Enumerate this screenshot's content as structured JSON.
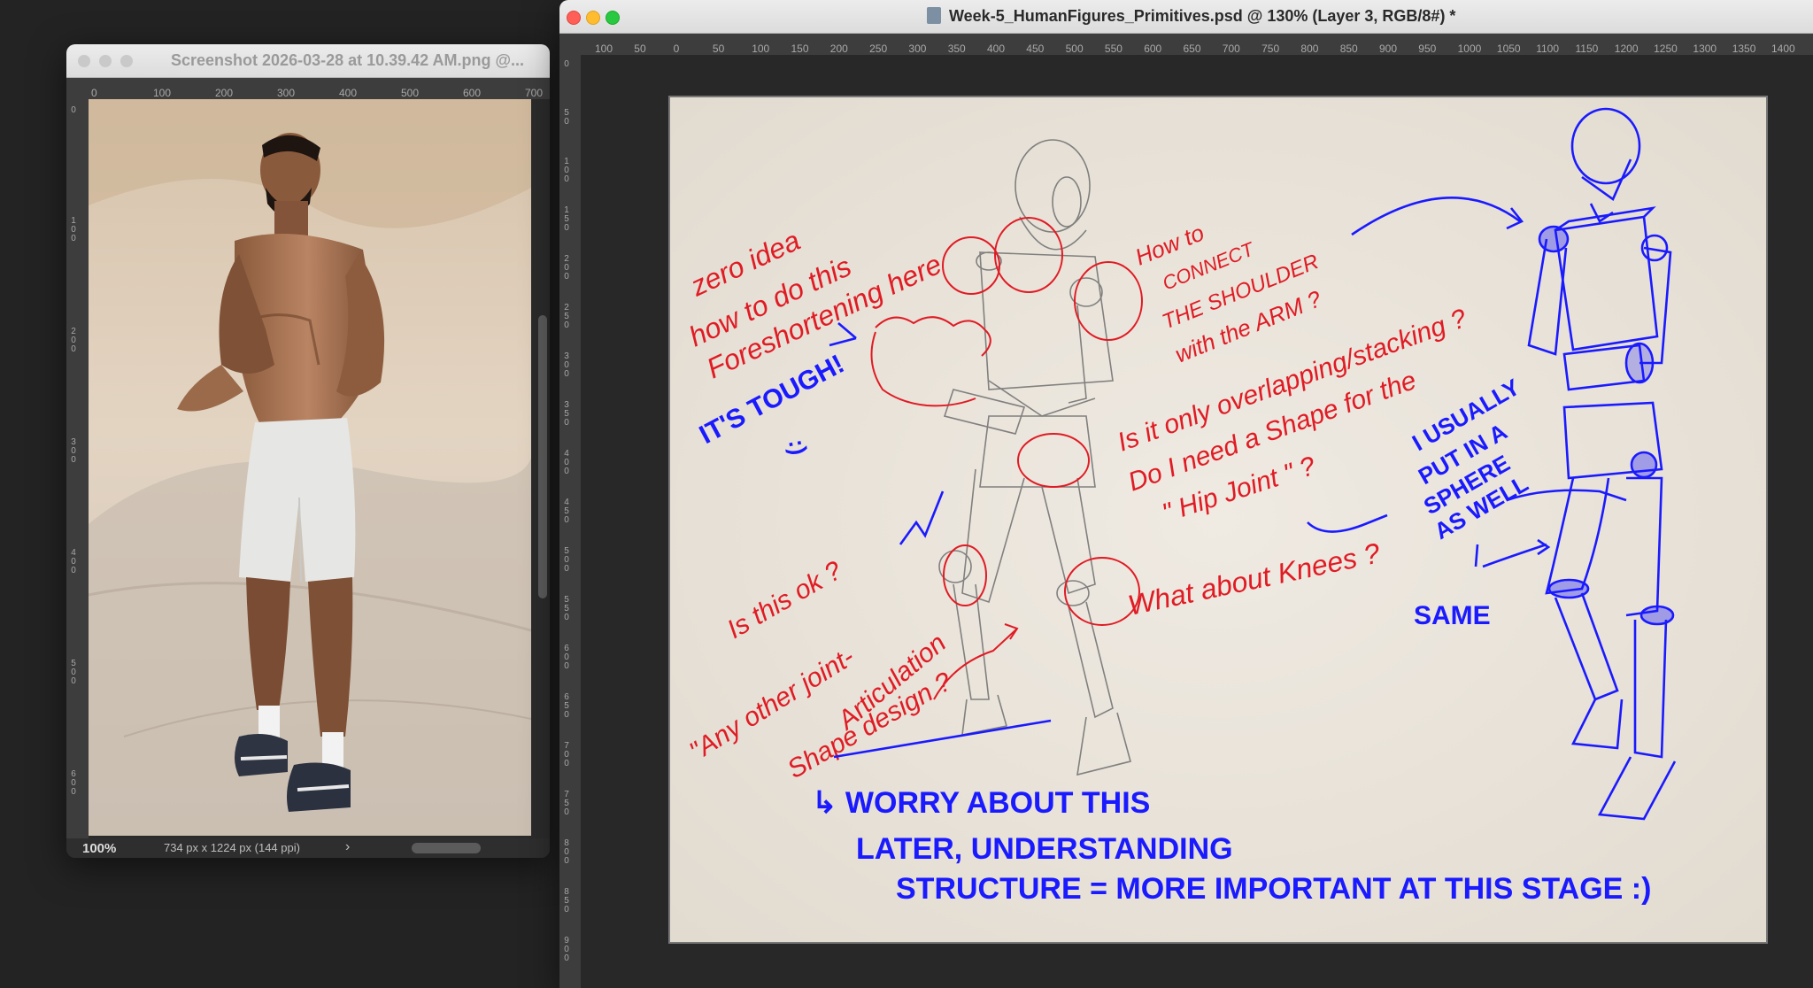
{
  "left_window": {
    "title": "Screenshot 2026-03-28 at 10.39.42 AM.png @...",
    "zoom": "100%",
    "info": "734 px x 1224 px (144 ppi)",
    "chevron": "›",
    "ruler_ticks": [
      "0",
      "100",
      "200",
      "300",
      "400",
      "500",
      "600",
      "700"
    ]
  },
  "main_window": {
    "title": "Week-5_HumanFigures_Primitives.psd @ 130% (Layer 3, RGB/8#) *",
    "doc_icon": "psd-document-icon",
    "ruler_ticks": [
      "100",
      "50",
      "0",
      "50",
      "100",
      "150",
      "200",
      "250",
      "300",
      "350",
      "400",
      "450",
      "500",
      "550",
      "600",
      "650",
      "700",
      "750",
      "800",
      "850",
      "900",
      "950",
      "1000",
      "1050",
      "1100",
      "1150",
      "1200",
      "1250",
      "1300",
      "1350",
      "1400"
    ]
  },
  "notes": {
    "red": {
      "foreshortening_1": "zero idea",
      "foreshortening_2": "how to do this",
      "foreshortening_3": "Foreshortening here",
      "shoulder_1": "How to",
      "shoulder_2": "CONNECT",
      "shoulder_3": "THE SHOULDER",
      "shoulder_4": "with the ARM ?",
      "hip_1": "Is it only overlapping/stacking ?",
      "hip_2": "Do I need a Shape for the",
      "hip_3": "\" Hip Joint \" ?",
      "knees": "What about Knees ?",
      "ok": "Is this ok ?",
      "joint_1": "\"Any other joint-",
      "joint_2": "Articulation",
      "joint_3": "Shape design ?"
    },
    "blue": {
      "tough": "IT'S TOUGH!",
      "smiley": ":)",
      "checkmark": "✓",
      "sphere_1": "I USUALLY",
      "sphere_2": "PUT IN A",
      "sphere_3": "SPHERE",
      "sphere_4": "AS WELL",
      "same": "SAME",
      "bottom_1": "↳ WORRY ABOUT THIS",
      "bottom_2": "LATER, UNDERSTANDING",
      "bottom_3": "STRUCTURE = MORE IMPORTANT AT THIS STAGE :)"
    }
  },
  "colors": {
    "red_pen": "#e01b24",
    "blue_pen": "#1a1aff",
    "canvas_paper": "#ece7df",
    "workspace": "#282828",
    "ruler_bg": "#3d3d3d"
  }
}
